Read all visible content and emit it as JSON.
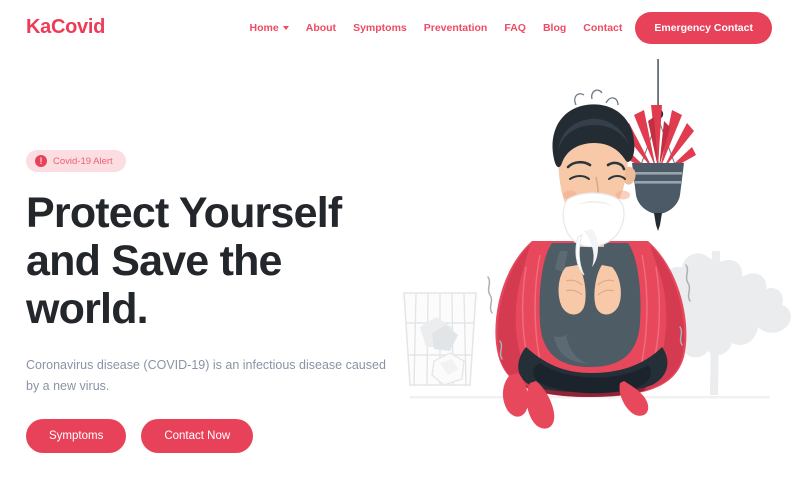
{
  "brand": {
    "name": "KaCovid"
  },
  "nav": {
    "items": [
      {
        "label": "Home",
        "has_dropdown": true
      },
      {
        "label": "About",
        "has_dropdown": false
      },
      {
        "label": "Symptoms",
        "has_dropdown": false
      },
      {
        "label": "Preventation",
        "has_dropdown": false
      },
      {
        "label": "FAQ",
        "has_dropdown": false
      },
      {
        "label": "Blog",
        "has_dropdown": false
      },
      {
        "label": "Contact",
        "has_dropdown": false
      }
    ],
    "cta_label": "Emergency Contact"
  },
  "hero": {
    "badge": {
      "icon": "alert-circle-icon",
      "glyph": "!",
      "label": "Covid-19 Alert"
    },
    "title": "Protect Yourself and Save the world.",
    "subtitle": "Coronavirus disease (COVID-19) is an infectious disease caused by a new virus.",
    "buttons": [
      {
        "label": "Symptoms"
      },
      {
        "label": "Contact Now"
      }
    ],
    "illustration": {
      "name": "sick-man-sneezing-illustration",
      "elements": [
        "hanging-plant-icon",
        "wastebasket-icon",
        "crumpled-tissue-icon",
        "decorative-leaf-icon",
        "person-with-blanket-icon",
        "tissue-icon"
      ]
    }
  },
  "colors": {
    "accent": "#e8415a",
    "accent_light": "#ef4b64",
    "badge_bg": "#fbdde2",
    "heading": "#23262b",
    "body_text": "#8a93a5",
    "blanket_red": "#e8485c",
    "blanket_dark": "#8e2436",
    "shirt_slate": "#4e5c66",
    "pants_dark": "#252f38",
    "hair_dark": "#232b33",
    "skin": "#f7c9a8",
    "leaf_gray": "#ebecee",
    "page_bg": "#ffffff"
  }
}
